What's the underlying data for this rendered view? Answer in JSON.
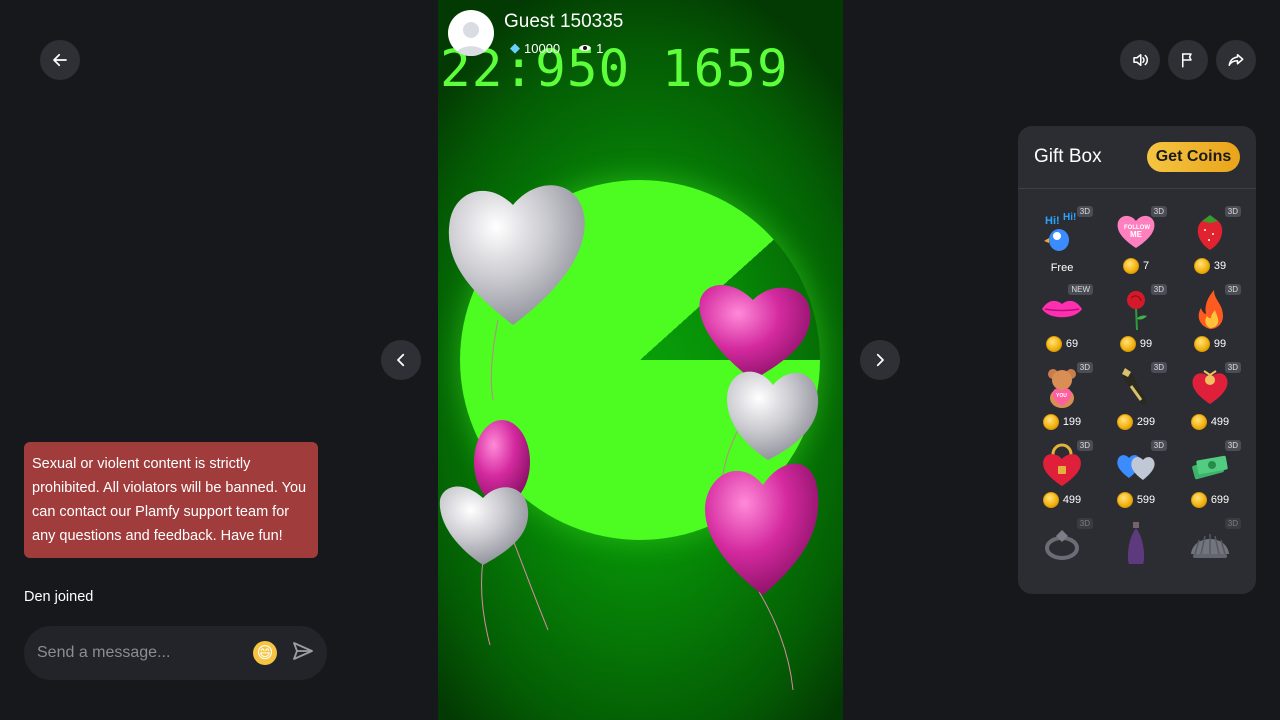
{
  "host": {
    "name": "Guest 150335",
    "diamonds": "10000",
    "viewers": "1"
  },
  "stream": {
    "overlay_text": "22:950 1659"
  },
  "chat": {
    "notice": "Sexual or violent content is strictly prohibited. All violators will be banned. You can contact our Plamfy support team for any questions and feedback. Have fun!",
    "joined": "Den joined",
    "input_placeholder": "Send a message..."
  },
  "gift_box": {
    "title": "Gift Box",
    "get_coins_label": "Get Coins",
    "gifts": [
      {
        "icon": "hi-parrot-icon",
        "badge": "3D",
        "price": "Free",
        "free": true
      },
      {
        "icon": "follow-me-heart-icon",
        "badge": "3D",
        "price": "7"
      },
      {
        "icon": "strawberry-icon",
        "badge": "3D",
        "price": "39"
      },
      {
        "icon": "lips-icon",
        "badge": "NEW",
        "price": "69"
      },
      {
        "icon": "rose-icon",
        "badge": "3D",
        "price": "99"
      },
      {
        "icon": "fire-icon",
        "badge": "3D",
        "price": "99"
      },
      {
        "icon": "teddy-bear-icon",
        "badge": "3D",
        "price": "199"
      },
      {
        "icon": "champagne-icon",
        "badge": "3D",
        "price": "299"
      },
      {
        "icon": "gift-box-heart-icon",
        "badge": "3D",
        "price": "499"
      },
      {
        "icon": "heart-lock-icon",
        "badge": "3D",
        "price": "499"
      },
      {
        "icon": "double-heart-icon",
        "badge": "3D",
        "price": "599"
      },
      {
        "icon": "money-stack-icon",
        "badge": "3D",
        "price": "699"
      },
      {
        "icon": "ring-icon",
        "badge": "3D",
        "price": ""
      },
      {
        "icon": "perfume-icon",
        "badge": "",
        "price": ""
      },
      {
        "icon": "seashell-icon",
        "badge": "3D",
        "price": ""
      }
    ]
  }
}
